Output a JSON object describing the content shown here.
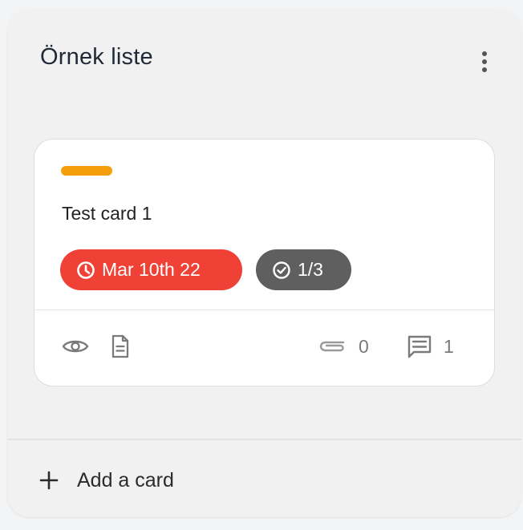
{
  "list": {
    "title": "Örnek liste",
    "menu_icon": "more-vertical-icon",
    "cards": [
      {
        "label_color": "#f59e0b",
        "title": "Test card 1",
        "due_badge": {
          "text": "Mar 10th 22",
          "color": "#ef4136",
          "icon": "clock-icon"
        },
        "checklist_badge": {
          "text": "1/3",
          "color": "#5f5f5f",
          "icon": "check-circle-icon"
        },
        "footer": {
          "watch_icon": "eye-icon",
          "description_icon": "document-icon",
          "attachments_icon": "paperclip-icon",
          "attachments_count": "0",
          "comments_icon": "comment-icon",
          "comments_count": "1"
        }
      }
    ],
    "add_card": {
      "label": "Add a card",
      "icon": "plus-icon"
    }
  },
  "colors": {
    "background": "#f3f4f6",
    "list_background": "#f1f1f1",
    "card_background": "#ffffff",
    "icon_gray": "#7a7a7a"
  }
}
